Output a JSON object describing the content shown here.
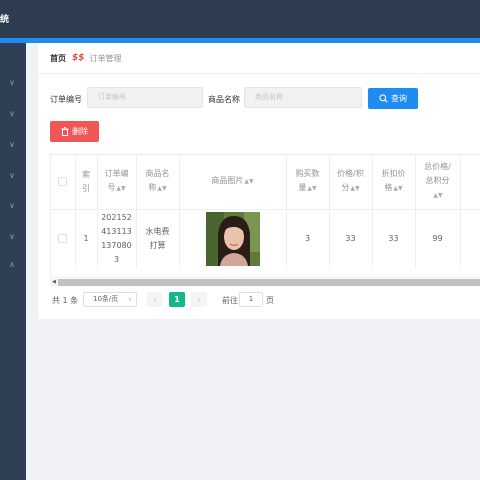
{
  "header": {
    "brand": "统"
  },
  "breadcrumb": {
    "home": "首页",
    "separator": "$$",
    "current": "订单管理"
  },
  "filters": {
    "order_no_label": "订单编号",
    "order_no_placeholder": "订单编号",
    "product_name_label": "商品名称",
    "product_name_placeholder": "商品名称",
    "search_label": "查询"
  },
  "toolbar": {
    "delete_label": "删除"
  },
  "table": {
    "columns": {
      "index": [
        "索",
        "引"
      ],
      "order_no": [
        "订单编",
        "号"
      ],
      "product_name": [
        "商品名",
        "称"
      ],
      "image": [
        "商品图片"
      ],
      "quantity": [
        "购买数",
        "量"
      ],
      "price": [
        "价格/积",
        "分"
      ],
      "discount": [
        "折扣价",
        "格"
      ],
      "total": [
        "总价格/",
        "总积分"
      ]
    },
    "rows": [
      {
        "index": "1",
        "order_no": [
          "202152",
          "413113",
          "137080",
          "3"
        ],
        "product_name": [
          "水电费",
          "打算"
        ],
        "quantity": "3",
        "price": "33",
        "discount": "33",
        "total": "99"
      }
    ]
  },
  "pagination": {
    "total": "共 1 条",
    "page_size": "10条/页",
    "current_page": "1",
    "goto_label": "前往",
    "goto_value": "1",
    "page_unit": "页"
  },
  "colors": {
    "primary": "#1f8cf3",
    "danger": "#f05656",
    "active_page": "#13b88a",
    "topbar": "#2e3c50",
    "sidebar": "#2f3f54"
  }
}
